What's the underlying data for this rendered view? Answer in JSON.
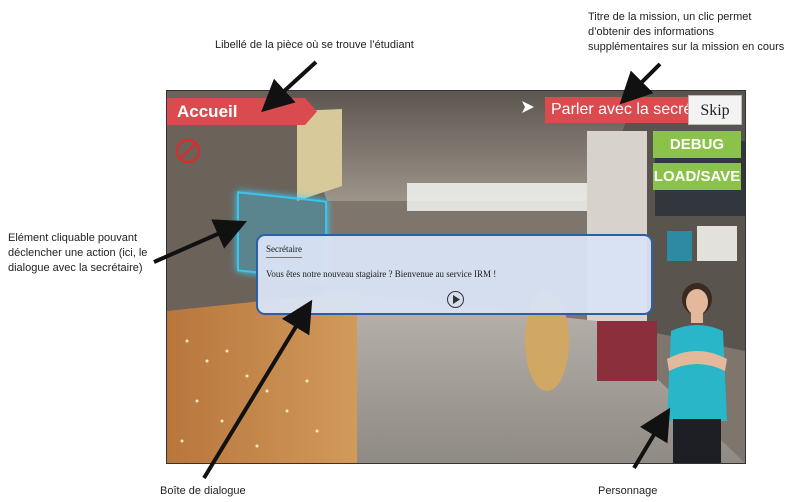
{
  "annotations": {
    "room_label": "Libellé de la pièce où se trouve l’étudiant",
    "mission_title": "Titre de la mission, un clic permet d’obtenir des informations supplémentaires sur la mission en cours",
    "clickable_element": "Elément cliquable pouvant déclencher une action (ici, le dialogue avec la secrétaire)",
    "dialog_box": "Boîte de dialogue",
    "character": "Personnage"
  },
  "game": {
    "room_name": "Accueil",
    "mission_title": "Parler avec la secrétaire",
    "skip_label": "Skip",
    "debug_label": "DEBUG",
    "load_save_label": "LOAD/SAVE",
    "dialog": {
      "speaker": "Secrétaire",
      "text": "Vous êtes notre nouveau stagiaire ? Bienvenue au service IRM !"
    }
  },
  "colors": {
    "banner_red": "#d94b4e",
    "button_green": "#8bc34a",
    "highlight_cyan": "#39c5ee",
    "dialog_border": "#2d5fa5"
  },
  "icons": [
    "forbidden-icon",
    "play-icon",
    "mission-cursor-icon"
  ]
}
